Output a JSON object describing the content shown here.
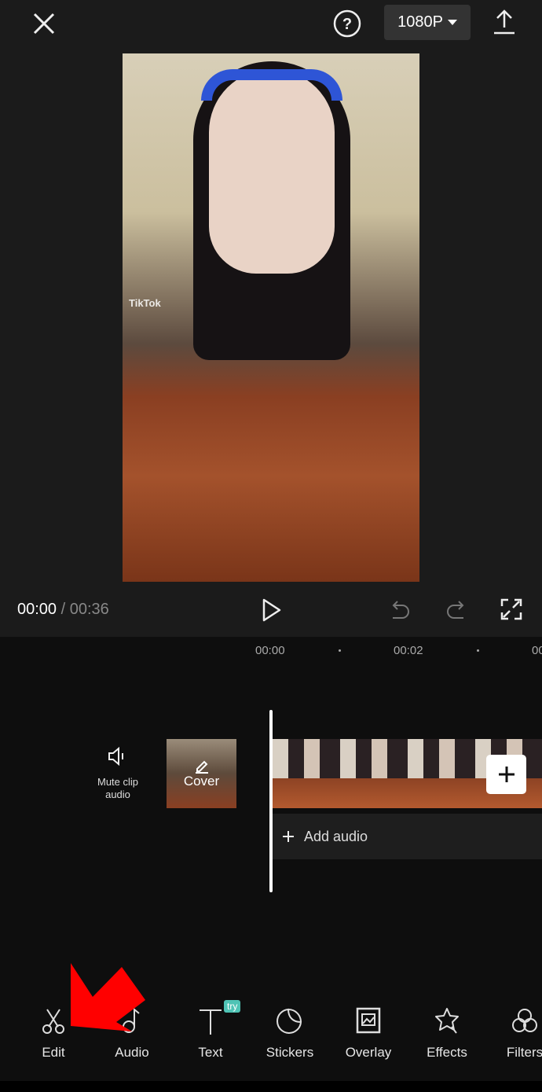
{
  "header": {
    "resolution": "1080P",
    "icons": [
      "close-icon",
      "help-icon",
      "export-icon"
    ]
  },
  "video": {
    "watermark": "TikTok"
  },
  "player": {
    "current_time": "00:00",
    "separator": "/",
    "total_time": "00:36"
  },
  "ruler": {
    "ticks": [
      "00:00",
      "00:02",
      "00"
    ]
  },
  "timeline": {
    "mute_label": "Mute clip audio",
    "cover_label": "Cover",
    "add_audio_label": "Add audio"
  },
  "toolbar": {
    "items": [
      {
        "label": "Edit",
        "icon": "scissors-icon"
      },
      {
        "label": "Audio",
        "icon": "music-note-icon"
      },
      {
        "label": "Text",
        "icon": "text-icon",
        "badge": "try"
      },
      {
        "label": "Stickers",
        "icon": "sticker-icon"
      },
      {
        "label": "Overlay",
        "icon": "overlay-icon"
      },
      {
        "label": "Effects",
        "icon": "effects-star-icon"
      },
      {
        "label": "Filters",
        "icon": "filters-icon"
      }
    ]
  },
  "colors": {
    "annotation_arrow": "#ff0000",
    "badge": "#4fc3b5",
    "background": "#1b1b1b"
  }
}
